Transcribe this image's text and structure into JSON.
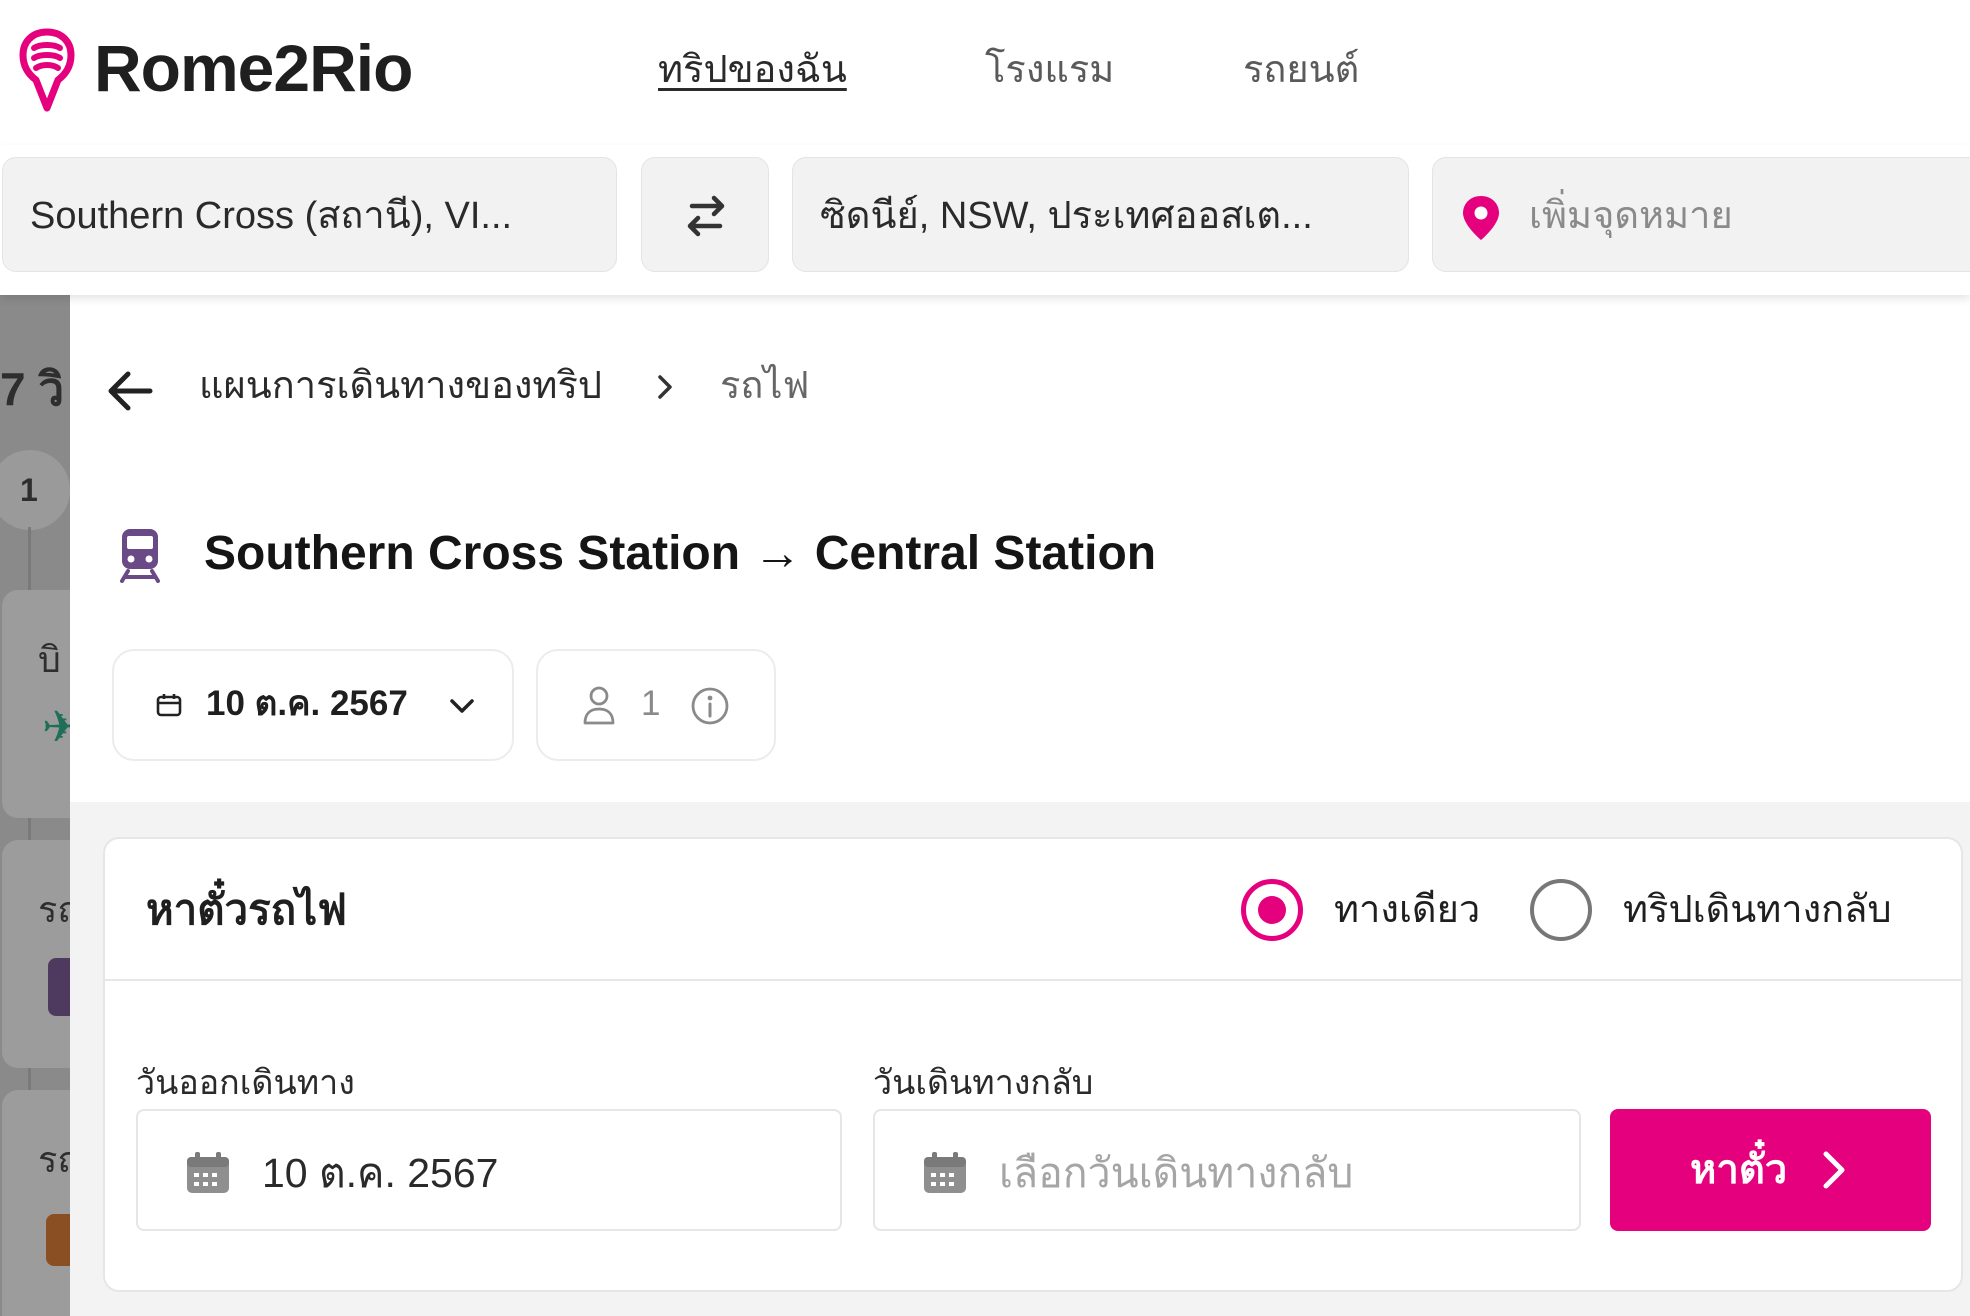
{
  "brand": {
    "name": "Rome2Rio",
    "accent": "#E5007D"
  },
  "nav": {
    "items": [
      {
        "label": "ทริปของฉัน",
        "active": true
      },
      {
        "label": "โรงแรม"
      },
      {
        "label": "รถยนต์"
      }
    ]
  },
  "search": {
    "origin": "Southern Cross (สถานี), VI...",
    "destination": "ซิดนีย์, NSW, ประเทศออสเต...",
    "add_destination_placeholder": "เพิ่มจุดหมาย",
    "swap_icon": "swap-arrows-icon"
  },
  "background_list": {
    "duration_fragment": "7 วิ",
    "step_badge": "1",
    "item_fragments": [
      "บิ",
      "รถ",
      "รถ"
    ]
  },
  "breadcrumb": {
    "back_icon": "arrow-left-icon",
    "parent": "แผนการเดินทางของทริป",
    "separator_icon": "chevron-right-icon",
    "current": "รถไฟ"
  },
  "route": {
    "mode_icon": "train-icon",
    "title": "Southern Cross Station → Central Station"
  },
  "filters": {
    "date": "10 ต.ค. 2567",
    "passengers": "1"
  },
  "booking": {
    "title": "หาตั๋วรถไฟ",
    "trip_types": [
      {
        "label": "ทางเดียว",
        "selected": true
      },
      {
        "label": "ทริปเดินทางกลับ",
        "selected": false
      }
    ],
    "depart_label": "วันออกเดินทาง",
    "depart_value": "10 ต.ค. 2567",
    "return_label": "วันเดินทางกลับ",
    "return_placeholder": "เลือกวันเดินทางกลับ",
    "search_button": "หาตั๋ว"
  }
}
